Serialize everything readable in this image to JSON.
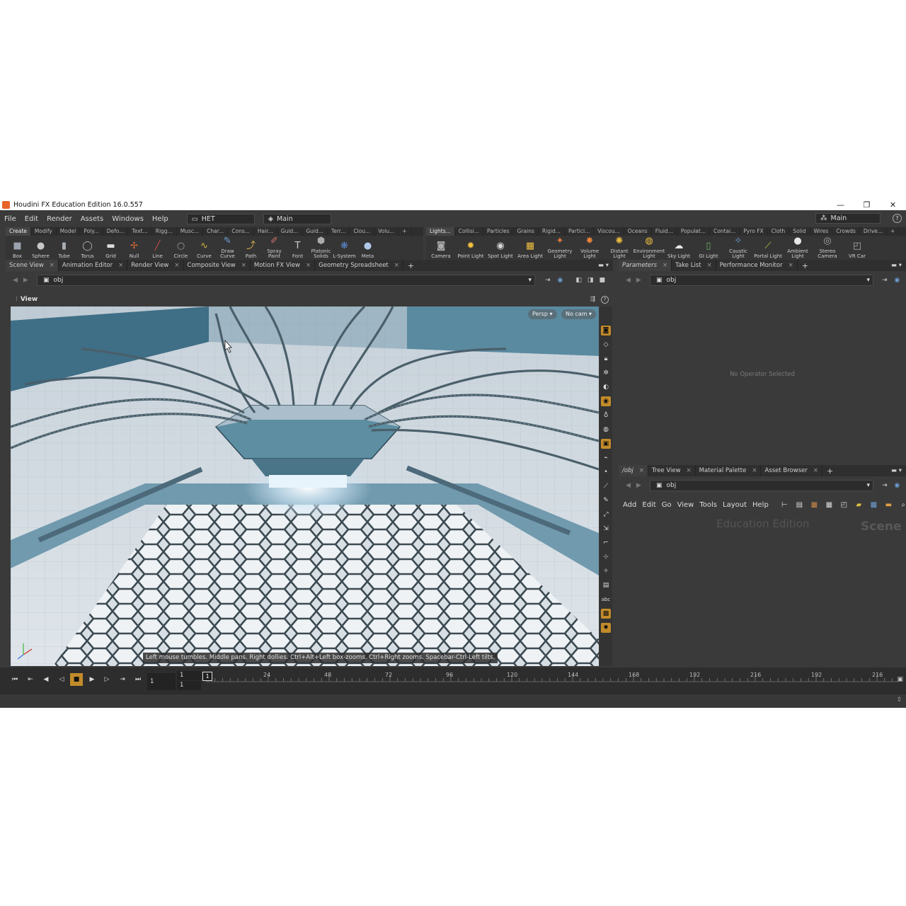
{
  "window": {
    "title": "Houdini FX Education Edition 16.0.557",
    "controls": [
      "—",
      "❐",
      "✕"
    ]
  },
  "menubar": {
    "items": [
      "File",
      "Edit",
      "Render",
      "Assets",
      "Windows",
      "Help"
    ],
    "desktop_left": "HET",
    "desktop_mid": "Main",
    "desktop_right": "Main",
    "help_glyph": "?"
  },
  "shelf_left": {
    "tabs": [
      "Create",
      "Modify",
      "Model",
      "Poly...",
      "Defo...",
      "Text...",
      "Rigg...",
      "Musc...",
      "Char...",
      "Cons...",
      "Hair...",
      "Guid...",
      "Guid...",
      "Terr...",
      "Clou...",
      "Volu..."
    ],
    "tools": [
      {
        "label": "Box",
        "icon": "box-icon",
        "glyph": "■",
        "color": "#9aa3ad"
      },
      {
        "label": "Sphere",
        "icon": "sphere-icon",
        "glyph": "●",
        "color": "#c8c8c8"
      },
      {
        "label": "Tube",
        "icon": "tube-icon",
        "glyph": "▮",
        "color": "#aab0b6"
      },
      {
        "label": "Torus",
        "icon": "torus-icon",
        "glyph": "◯",
        "color": "#b8b8b8"
      },
      {
        "label": "Grid",
        "icon": "grid-icon",
        "glyph": "▬",
        "color": "#dddddd"
      },
      {
        "label": "Null",
        "icon": "null-icon",
        "glyph": "✢",
        "color": "#d96a3a"
      },
      {
        "label": "Line",
        "icon": "line-icon",
        "glyph": "╱",
        "color": "#c84a4a"
      },
      {
        "label": "Circle",
        "icon": "circle-icon",
        "glyph": "○",
        "color": "#9a9a9a"
      },
      {
        "label": "Curve",
        "icon": "curve-icon",
        "glyph": "∿",
        "color": "#d6b24a"
      },
      {
        "label": "Draw Curve",
        "icon": "draw-curve-icon",
        "glyph": "✎",
        "color": "#6fa0d8"
      },
      {
        "label": "Path",
        "icon": "path-icon",
        "glyph": "⤴",
        "color": "#d6b24a"
      },
      {
        "label": "Spray Paint",
        "icon": "spray-paint-icon",
        "glyph": "✐",
        "color": "#d06a6a"
      },
      {
        "label": "Font",
        "icon": "font-icon",
        "glyph": "T",
        "color": "#cccccc"
      },
      {
        "label": "Platonic Solids",
        "icon": "platonic-solids-icon",
        "glyph": "⬢",
        "color": "#aaaaaa"
      },
      {
        "label": "L-System",
        "icon": "l-system-icon",
        "glyph": "❋",
        "color": "#5a8ad0"
      },
      {
        "label": "Meta",
        "icon": "metaball-icon",
        "glyph": "●",
        "color": "#b0c8e8"
      }
    ]
  },
  "shelf_right": {
    "tabs": [
      "Lights...",
      "Collisi...",
      "Particles",
      "Grains",
      "Rigid...",
      "Particl...",
      "Viscou...",
      "Oceans",
      "Fluid...",
      "Populat...",
      "Contai...",
      "Pyro FX",
      "Cloth",
      "Solid",
      "Wires",
      "Crowds",
      "Drive..."
    ],
    "tools": [
      {
        "label": "Camera",
        "icon": "camera-icon",
        "glyph": "◙",
        "color": "#aaaaaa"
      },
      {
        "label": "Point Light",
        "icon": "point-light-icon",
        "glyph": "✹",
        "color": "#f0c040"
      },
      {
        "label": "Spot Light",
        "icon": "spot-light-icon",
        "glyph": "◉",
        "color": "#d8d8d8"
      },
      {
        "label": "Area Light",
        "icon": "area-light-icon",
        "glyph": "▦",
        "color": "#f0c040"
      },
      {
        "label": "Geometry Light",
        "icon": "geometry-light-icon",
        "glyph": "✦",
        "color": "#e07a3a"
      },
      {
        "label": "Volume Light",
        "icon": "volume-light-icon",
        "glyph": "✸",
        "color": "#e8823a"
      },
      {
        "label": "Distant Light",
        "icon": "distant-light-icon",
        "glyph": "✺",
        "color": "#f0c040"
      },
      {
        "label": "Environment Light",
        "icon": "environment-light-icon",
        "glyph": "◍",
        "color": "#f0c040"
      },
      {
        "label": "Sky Light",
        "icon": "sky-light-icon",
        "glyph": "☁",
        "color": "#e8e8e8"
      },
      {
        "label": "GI Light",
        "icon": "gi-light-icon",
        "glyph": "▯",
        "color": "#6ab06a"
      },
      {
        "label": "Caustic Light",
        "icon": "caustic-light-icon",
        "glyph": "✧",
        "color": "#6fa0d8"
      },
      {
        "label": "Portal Light",
        "icon": "portal-light-icon",
        "glyph": "⟋",
        "color": "#c8c83a"
      },
      {
        "label": "Ambient Light",
        "icon": "ambient-light-icon",
        "glyph": "●",
        "color": "#e8e8e8"
      },
      {
        "label": "Stereo Camera",
        "icon": "stereo-camera-icon",
        "glyph": "◎",
        "color": "#aaaaaa"
      },
      {
        "label": "VR Car",
        "icon": "vr-camera-icon",
        "glyph": "◰",
        "color": "#aaaaaa"
      }
    ]
  },
  "scene_tabs": [
    "Scene View",
    "Animation Editor",
    "Render View",
    "Composite View",
    "Motion FX View",
    "Geometry Spreadsheet"
  ],
  "scene_path": "obj",
  "view_label": "View",
  "viewport": {
    "persp_btn": "Persp ▾",
    "cam_btn": "No cam ▾",
    "hint": "Left mouse tumbles. Middle pans. Right dollies. Ctrl+Alt+Left box-zooms. Ctrl+Right zooms. Spacebar-Ctrl-Left tilts."
  },
  "param_tabs": [
    "Parameters",
    "Take List",
    "Performance Monitor"
  ],
  "param_path": "obj",
  "param_empty": "No Operator Selected",
  "net_tabs": [
    "/obj",
    "Tree View",
    "Material Palette",
    "Asset Browser"
  ],
  "net_path": "obj",
  "net_menu": [
    "Add",
    "Edit",
    "Go",
    "View",
    "Tools",
    "Layout",
    "Help"
  ],
  "net_watermark": "Education Edition",
  "net_context": "Scene",
  "timeline": {
    "current_frame": "1",
    "start_frame": "1",
    "end_frame": "1",
    "marker": "1",
    "tick_labels": [
      "24",
      "48",
      "72",
      "96",
      "120",
      "144",
      "168",
      "192",
      "216",
      "192",
      "216"
    ]
  }
}
